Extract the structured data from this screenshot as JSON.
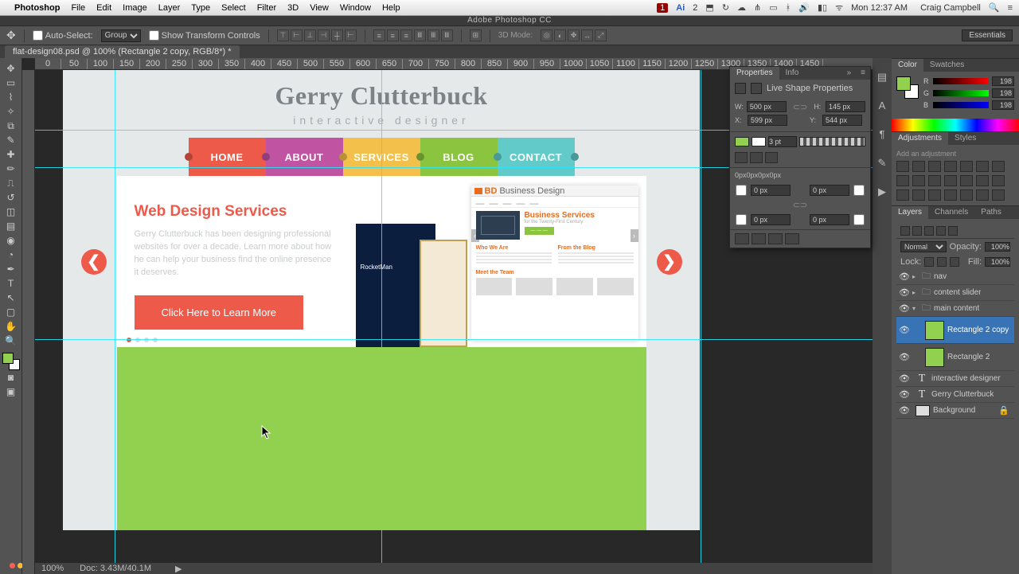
{
  "menubar": {
    "app": "Photoshop",
    "items": [
      "File",
      "Edit",
      "Image",
      "Layer",
      "Type",
      "Select",
      "Filter",
      "3D",
      "View",
      "Window",
      "Help"
    ],
    "status": {
      "time": "Mon 12:37 AM",
      "user": "Craig Campbell",
      "ai": "Ai",
      "two": "2"
    }
  },
  "app_title": "Adobe Photoshop CC",
  "options": {
    "auto_select": "Auto-Select:",
    "group": "Group",
    "show_transform": "Show Transform Controls",
    "mode_3d": "3D Mode:",
    "workspace": "Essentials"
  },
  "doc_tab": "flat-design08.psd @ 100% (Rectangle 2 copy, RGB/8*) *",
  "ruler_marks": [
    "0",
    "50",
    "100",
    "150",
    "200",
    "250",
    "300",
    "350",
    "400",
    "450",
    "500",
    "550",
    "600",
    "650",
    "700",
    "750",
    "800",
    "850",
    "900",
    "950",
    "1000",
    "1050",
    "1100",
    "1150",
    "1200",
    "1250",
    "1300",
    "1350",
    "1400",
    "1450"
  ],
  "site": {
    "title": "Gerry Clutterbuck",
    "subtitle": "interactive designer",
    "nav": [
      {
        "label": "HOME",
        "bg": "#ee5a4a"
      },
      {
        "label": "ABOUT",
        "bg": "#c054a3"
      },
      {
        "label": "SERVICES",
        "bg": "#f3c14b"
      },
      {
        "label": "BLOG",
        "bg": "#8bc53f"
      },
      {
        "label": "CONTACT",
        "bg": "#62cbc9"
      }
    ],
    "hero": {
      "heading": "Web Design Services",
      "heading_color": "#ee5a4a",
      "body": "Gerry Clutterbuck has been designing professional websites for over a decade. Learn more about how he can help your business find the online presence it deserves.",
      "cta": "Click Here to Learn More",
      "cta_bg": "#ee5a4a",
      "arrow_bg": "#ee5a4a"
    },
    "mock": {
      "brand": "BD",
      "brand2": "Business Design",
      "h": "Business Services",
      "sub": "for the Twenty-First Century",
      "col1": "Who We Are",
      "col2": "From the Blog",
      "team": "Meet the Team",
      "rocket": "RocketMan"
    }
  },
  "status_strip": {
    "zoom": "100%",
    "doc": "Doc: 3.43M/40.1M"
  },
  "panels": {
    "color": {
      "tab1": "Color",
      "tab2": "Swatches",
      "r": "198",
      "g": "198",
      "b": "198"
    },
    "adjustments": {
      "tab": "Adjustments",
      "tab2": "Styles",
      "hint": "Add an adjustment"
    },
    "layers": {
      "tab1": "Layers",
      "tab2": "Channels",
      "tab3": "Paths",
      "blend": "Normal",
      "opacity_l": "Opacity:",
      "opacity_v": "100%",
      "lock_l": "Lock:",
      "fill_l": "Fill:",
      "fill_v": "100%",
      "items": [
        {
          "type": "folder",
          "name": "nav",
          "indent": 0
        },
        {
          "type": "folder",
          "name": "content slider",
          "indent": 0
        },
        {
          "type": "folder",
          "name": "main content",
          "indent": 0,
          "open": true
        },
        {
          "type": "shape",
          "name": "Rectangle 2 copy",
          "indent": 1,
          "sel": true,
          "thumb": "green"
        },
        {
          "type": "shape",
          "name": "Rectangle 2",
          "indent": 1,
          "thumb": "green"
        },
        {
          "type": "text",
          "name": "interactive designer",
          "indent": 0
        },
        {
          "type": "text",
          "name": "Gerry Clutterbuck",
          "indent": 0
        },
        {
          "type": "bg",
          "name": "Background",
          "indent": 0,
          "locked": true
        }
      ]
    },
    "props": {
      "tab1": "Properties",
      "tab2": "Info",
      "title": "Live Shape Properties",
      "w_l": "W:",
      "w": "500 px",
      "h_l": "H:",
      "h": "145 px",
      "x_l": "X:",
      "x": "599 px",
      "y_l": "Y:",
      "y": "544 px",
      "stroke_w": "3 pt",
      "path": "0px0px0px0px",
      "corner": "0 px"
    }
  }
}
